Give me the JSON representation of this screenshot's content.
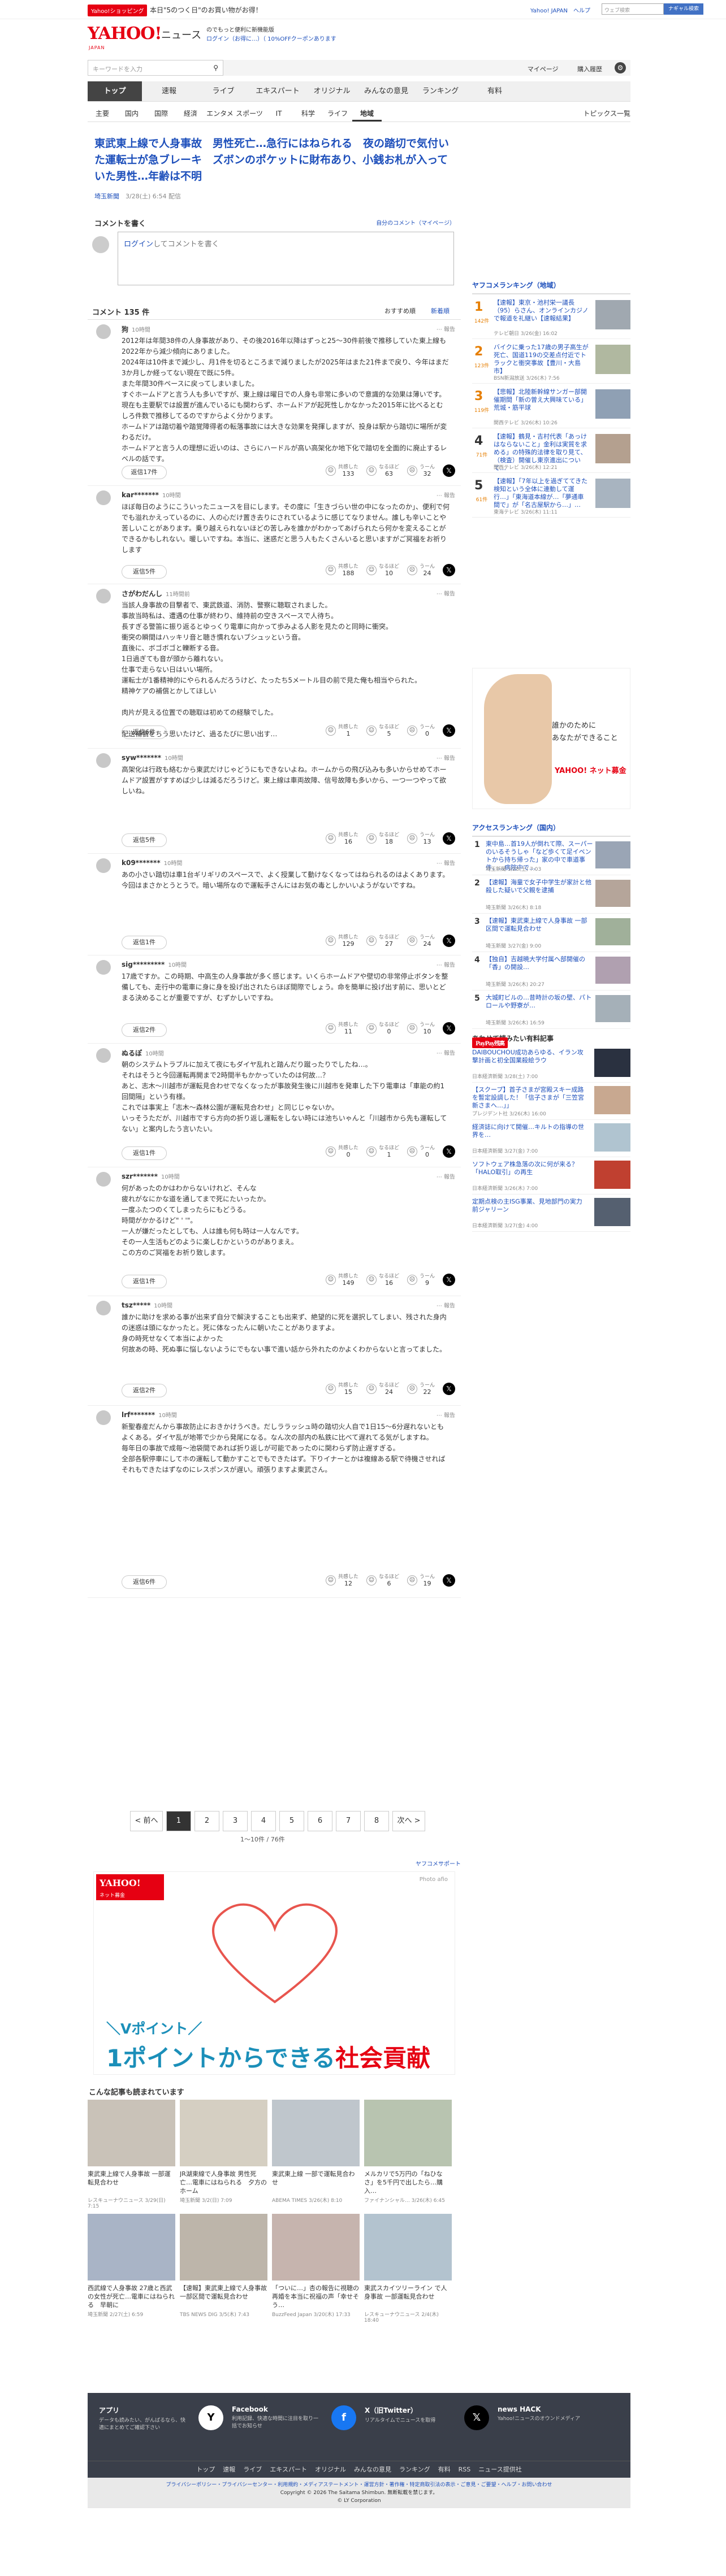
{
  "promo": {
    "badge": "Yahoo!ショッピング",
    "text": "本日\"5のつく日\"のお買い物がお得！",
    "right": "Yahoo! JAPAN　ヘルプ",
    "search_placeholder": "ウェブ検索",
    "search_btn": "ナギャル検索"
  },
  "header": {
    "logo": "YAHOO!",
    "logo_sub": "JAPAN",
    "news": "ニュース",
    "msg1": "LYPプレミアム",
    "msg2": "ログイン（お得に…）（ 10%OFFクーポンあります",
    "msg3": "のでもっと便利に新機能版"
  },
  "bar": {
    "search_placeholder": "キーワードを入力",
    "links": [
      "マイページ",
      "購入履歴"
    ]
  },
  "gnav": [
    "トップ",
    "速報",
    "ライブ",
    "エキスパート",
    "オリジナル",
    "みんなの意見",
    "ランキング",
    "有料"
  ],
  "snav": [
    "主要",
    "国内",
    "国際",
    "経済",
    "エンタメ",
    "スポーツ",
    "IT",
    "科学",
    "ライフ",
    "地域"
  ],
  "snav_right": "トピックス一覧",
  "article": {
    "title": "東武東上線で人身事故　男性死亡…急行にはねられる　夜の踏切で気付いた運転士が急ブレーキ　ズボンのポケットに財布あり、小銭お札が入っていた男性…年齢は不明",
    "publisher": "埼玉新聞",
    "date": "3/28(土) 6:54 配信"
  },
  "comment_head": {
    "title": "コメントを書く",
    "link": "自分のコメント（マイページ）",
    "placeholder_link": "ログイン",
    "placeholder": "してコメントを書く"
  },
  "clist": {
    "title": "コメント 135 件",
    "sort1": "おすすめ順",
    "sort2": "新着順"
  },
  "comments": [
    {
      "user": "狗",
      "time": "10時間",
      "body": "2012年は年間38件の人身事故があり、その後2016年以降はずっと25～30件前後で推移していた東上線も2022年から減少傾向にありました。\n2024年は10件まで減少し、月1件を切るところまで減りましたが2025年はまた21件まで戻り、今年はまだ3か月しか経ってない現在で既に5件。\nまた年間30件ペースに戻ってしまいました。\nすぐホームドアと言う人も多いですが、東上線は曜日での人身も非常に多いので意識的な効果は薄いです。\n現在も主要駅では設置が進んでいるにも関わらず、ホームドアが起死性しかなかった2015年に比べるとむしろ件数で推移してるのですからよく分かります。\nホームドアは踏切着や踏覚障得者の転落事故には大きな効果を発揮しますが、投身は駅から踏切に場所が変わるだけ。\nホームドアと言う人の理想に近いのは、さらにハードルが高い高架化か地下化で踏切を全面的に廃止するレベルの話です。",
      "reply": "返信17件",
      "reacts": [
        {
          "l": "共感した",
          "n": "133"
        },
        {
          "l": "なるほど",
          "n": "63"
        },
        {
          "l": "うーん",
          "n": "32"
        }
      ]
    },
    {
      "user": "kar*******",
      "time": "10時間",
      "body": "ほぼ毎日のようにこういったニュースを目にします。その度に「生きづらい世の中になったのか」、便利で何でも溢れかえっているのに、人の心だけ置き去りにされているように感じてなりません。誰しも辛いことや苦しいことがあります。乗り越えられないほどの苦しみを誰かがわかってあげられたら何かを変えることができるかもしれない。暖しいですね。本当に、迷惑だと思う人もたくさんいると思いますがご冥福をお祈りします",
      "reply": "返信5件",
      "reacts": [
        {
          "l": "共感した",
          "n": "188"
        },
        {
          "l": "なるほど",
          "n": "10"
        },
        {
          "l": "うーん",
          "n": "24"
        }
      ]
    },
    {
      "user": "さがわだんし",
      "time": "11時間前",
      "body": "当該人身事故の目撃者で、東武鉄道、消防、警察に聴取されました。\n事故当時私は、遭遇の仕事が終わり、維持前の空きスペースで人待ち。\n長すぎる警笛に振り返るとゆっくり電車に向かって歩みよる人影を見たのと同時に衝突。\n衝突の瞬間はハッキリ音と聴き慣れないブシュッという音。\n直後に、ボゴボゴと轢断する音。\n1日過ぎても音が頭から離れない。\n仕事で走らない日はいい場所。\n運転士が1番精神的にやられるんだろうけど、たったち5メートル目の前で見た俺も相当やられた。\n精神ケアの補償とかしてほしい\n\n肉片が見える位置での聴取は初めての経験でした。\n\n配送補償をちう思いたけど、過るたびに思い出す…",
      "reply": "返信6件",
      "reacts": [
        {
          "l": "共感した",
          "n": "1"
        },
        {
          "l": "なるほど",
          "n": "5"
        },
        {
          "l": "うーん",
          "n": "0"
        }
      ]
    },
    {
      "user": "syw*******",
      "time": "10時間",
      "body": "高架化は行政も絡むから東武だけじゃどうにもできないよね。ホームからの飛び込みも多いからせめてホームドア設置がすすめば少しは減るだろうけど。東上線は車両故障、信号故障も多いから、一つ一つやって欲しいね。",
      "reply": "返信5件",
      "reacts": [
        {
          "l": "共感した",
          "n": "16"
        },
        {
          "l": "なるほど",
          "n": "18"
        },
        {
          "l": "うーん",
          "n": "13"
        }
      ]
    },
    {
      "user": "k09*******",
      "time": "10時間",
      "body": "あの小さい踏切は車1台ギリギリのスペースで、よく授業して動けなくなってはねられるのはよくあります。今回はまさかとうとうで。暗い場所なので運転手さんにはお気の毒としかいいようがないですね。",
      "reply": "返信1件",
      "reacts": [
        {
          "l": "共感した",
          "n": "129"
        },
        {
          "l": "なるほど",
          "n": "27"
        },
        {
          "l": "うーん",
          "n": "24"
        }
      ]
    },
    {
      "user": "sig*********",
      "time": "10時間",
      "body": "17歳ですか。この時期、中高生の人身事故が多く感じます。いくらホームドアや壁切の非常停止ボタンを整備しても、走行中の電車に身に身を投げ出されたらほぼ間際でしょう。命を簡単に投げ出す前に、思いとどまる決めることが重要ですが、むずかしいですね。",
      "reply": "返信2件",
      "reacts": [
        {
          "l": "共感した",
          "n": "11"
        },
        {
          "l": "なるほど",
          "n": "0"
        },
        {
          "l": "うーん",
          "n": "10"
        }
      ]
    },
    {
      "user": "ぬるぽ",
      "time": "10時間",
      "body": "朝のシステムトラブルに加えて夜にもダイヤ乱れと踏んだり蹴ったりでしたね…。\nそれはそうと今回運転再開まで2時間半もかかっていたのは何故…？\nあと、志木〜川越市が運転見合わせでなくなったが事故発生後に川越市を発車した下り電車は「車能の約1回間隔」という有様。\nこれでは事実上「志木〜森林公園が運転見合わせ」と同じじゃないか。\nいっそうただが、川越市ですら方向の折り返し運転をしない時には池ちいゃんと「川越市から先も運転してない」と案内したう言いたい。",
      "reply": "返信1件",
      "reacts": [
        {
          "l": "共感した",
          "n": "0"
        },
        {
          "l": "なるほど",
          "n": "1"
        },
        {
          "l": "うーん",
          "n": "0"
        }
      ]
    },
    {
      "user": "szr*******",
      "time": "10時間",
      "body": "何があったのかはわからないけれど、そんな\n疲れがなにかな道を通してまで死にたいったか。\n一度ふたつのくてしまったらにもどうる。\n時間がかかるけど\" ' '\"。\n一人が嫌だったとしても、人は誰も何も時は一人なんです。\nその一人生活もどのように楽しむかというのがありまえ。\nこの方のご冥福をお祈り致します。",
      "reply": "返信1件",
      "reacts": [
        {
          "l": "共感した",
          "n": "149"
        },
        {
          "l": "なるほど",
          "n": "16"
        },
        {
          "l": "うーん",
          "n": "9"
        }
      ]
    },
    {
      "user": "tsz*****",
      "time": "10時間",
      "body": "誰かに助けを求める事が出来ず自分で解決することも出来ず、絶望的に死を選択してしまい、残された身内の迷惑は頭になかったと。死に体なったんに朝いたことがありますよ。\n身の時死せなくて本当によかった\n何故あの時、死ぬ事に悩しないようにでもない事で進い話から外れたのかよくわからないと言ってました。",
      "reply": "返信2件",
      "reacts": [
        {
          "l": "共感した",
          "n": "15"
        },
        {
          "l": "なるほど",
          "n": "24"
        },
        {
          "l": "うーん",
          "n": "22"
        }
      ]
    },
    {
      "user": "lrf*******",
      "time": "10時間",
      "body": "新聖春産だんから事故防止におきかけうべき。だしララッシュ時の踏切火人自で1日15〜6分遅れないともよくある。ダイヤ乱が地帯で少から発尾になる。なん次の部内の私鉄に比べて遅れてる気がしますね。\n毎年日の事故で成毎〜池袋間であれば折り返しが可能であったのに関わらず防止遅すぎる。\n全部各駅停車にしてホの運転して動かすことでもできたはず。下りイナーとかは複線ある駅で待機させればそれもできたはずなのにレスポンスが遅い。頑張りますよ東武さん。",
      "reply": "返信6件",
      "reacts": [
        {
          "l": "共感した",
          "n": "12"
        },
        {
          "l": "なるほど",
          "n": "6"
        },
        {
          "l": "うーん",
          "n": "19"
        }
      ]
    }
  ],
  "pager": {
    "prev": "< 前へ",
    "pages": [
      "1",
      "2",
      "3",
      "4",
      "5",
      "6",
      "7",
      "8"
    ],
    "next": "次へ >",
    "count": "1〜10件 / 76件"
  },
  "sponsor_label": "ヤフコメサポート",
  "ad": {
    "brand": "YAHOO!",
    "brand_sub": "ネット募金",
    "photo": "Photo afio",
    "line1": "＼Vポイント／",
    "line2a": "1ポイントからできる",
    "line2b": "社会貢献"
  },
  "recos": {
    "title": "こんな記事も読まれています",
    "items": [
      {
        "cap": "東武東上線で人身事故 一部運転見合わせ",
        "meta": "レスキューナウニュース 3/29(日) 7:15"
      },
      {
        "cap": "JR湖東線で人身事故 男性死亡…電車にはねられる　夕方のホーム",
        "meta": "埼玉新聞 3/2(日) 7:09"
      },
      {
        "cap": "東武東上線 一部で運転見合わせ",
        "meta": "ABEMA TIMES 3/26(木) 8:10"
      },
      {
        "cap": "メルカリで5万円の「ねひなさ」を5千円で出したら…購入…",
        "meta": "ファイナンシャル… 3/26(木) 6:45"
      },
      {
        "cap": "西武線で人身事故 27歳と西武の女性が死亡…電車にはねられる　早朝に",
        "meta": "埼玉新聞 2/27(土) 6:59"
      },
      {
        "cap": "【速報】東武東上線で人身事故　一部区間で運転見合わせ",
        "meta": "TBS NEWS DIG 3/5(木) 7:43"
      },
      {
        "cap": "「ついに…」杏の報告に視聴の再婚を本当に祝福の声「幸せそう…",
        "meta": "BuzzFeed Japan 3/20(木) 17:33"
      },
      {
        "cap": "東武スカイツリーライン で人身事故 一部運転見合わせ",
        "meta": "レスキューナウニュース 2/4(木) 18:40"
      }
    ]
  },
  "sidebar": {
    "ranking_title": "ヤフコメランキング（地域）",
    "ranks": [
      {
        "n": "1",
        "cnt": "142件",
        "txt": "【速報】東京・池村栄一議長（95）らさん、オンラインカジノで報道を礼継い【速報結果】",
        "src": "テレビ朝日 3/26(金) 16:02"
      },
      {
        "n": "2",
        "cnt": "123件",
        "txt": "バイクに乗った17歳の男子高生が死亡、国道119の交差点付近でトラックと衝突事故【豊川・大島市】",
        "src": "BSN新潟放送 3/26(木) 7:56"
      },
      {
        "n": "3",
        "cnt": "119件",
        "txt": "【悲報】北陸新幹線サンガー部開催期間「新の曽え大興味ている」荒城・筋平球",
        "src": "関西テレビ 3/26(木) 10:26"
      },
      {
        "n": "4",
        "cnt": "71件",
        "txt": "【速報】鶴見・吉村代表「あっけはならないこと」金利は実質を求める」の特殊的法律を取り見て、（検査）開催し東京進出について…",
        "src": "関西テレビ 3/26(木) 12:21"
      },
      {
        "n": "5",
        "cnt": "61件",
        "txt": "【速報】「7年以上を過ぎててきた検知という全体に連動して運行…」「東海道本線が…「夢通車間で」が「名古屋駅から…」…",
        "src": "東海テレビ 3/26(木) 11:11"
      }
    ],
    "ad_t1": "誰かのために",
    "ad_t2": "あなたができること",
    "ad_brand": "YAHOO! ネット募金",
    "access_title": "アクセスランキング（国内）",
    "access": [
      {
        "n": "1",
        "txt": "東中島…首19人が倒れて際、スーパーのいるそうしゃ「など歩くて足イベントから持ち帰った」家の中で車道事件、…病院中で…",
        "src": "埼玉新聞 3/28(土) 7:03"
      },
      {
        "n": "2",
        "txt": "【速報】海童で女子中学生が家計と他殺した疑いで父親を逮捕",
        "src": "埼玉新聞 3/26(木) 8:18"
      },
      {
        "n": "3",
        "txt": "【速報】東武東上線で人身事故 一部区間で運転見合わせ",
        "src": "埼玉新聞 3/27(金) 9:00"
      },
      {
        "n": "4",
        "txt": "【独自】吉越暁大学付属へ部開催の「香」の開設…",
        "src": "埼玉新聞 3/26(木) 20:27"
      },
      {
        "n": "5",
        "txt": "大城町ビルの…昔時計の坂の壁、パトロールや野寮が…",
        "src": "埼玉新聞 3/26(木) 16:59"
      }
    ],
    "pp_head": "あわせて読みたい有料記事",
    "pp_logo": "PayPay残高",
    "pp": [
      {
        "txt": "DAIBOUCHOU成功あらゆる、イラン攻撃計画と初全国業殺絵ラウ",
        "src": "日本経済新聞 3/28(土) 7:00"
      },
      {
        "txt": "【スクープ】首子さまが宮殿スキー成路を暫定設調した！「信子さまが「三笠宮新さまへ…」」",
        "src": "プレジデント社 3/26(木) 16:00"
      },
      {
        "txt": "経済誌に向けて開催…キルトの指導の世界を…",
        "src": "日本経済新聞 3/27(金) 7:00"
      },
      {
        "txt": "ソフトウェア株急落の次に何が来る？「HALO取引」の再生",
        "src": "日本経済新聞 3/26(木) 7:00"
      },
      {
        "txt": "定期点検の主ISG事業、見地部門の実力前ジャリーン",
        "src": "日本経済新聞 3/27(金) 4:00"
      }
    ]
  },
  "footer": {
    "cols": [
      {
        "h": "アプリ",
        "d": "データも読みたい、がんばるなら、快適にまとめてご確認下さい"
      },
      {
        "h": "Facebook",
        "d": "利用記録、快適な時間に注目を取り一括でお知らせ"
      },
      {
        "h": "X（旧Twitter）",
        "d": "リアルタイムでニュースを取得"
      },
      {
        "h": "news HACK",
        "d": "Yahoo!ニュースのオウンドメディア"
      }
    ],
    "links": [
      "トップ",
      "速報",
      "ライブ",
      "エキスパート",
      "オリジナル",
      "みんなの意見",
      "ランキング",
      "有料",
      "RSS",
      "ニュース提供社"
    ],
    "legal": "プライバシーポリシー・プライバシーセンター・利用規約・メディアステートメント・運営方針・著作権・特定商取引法の表示・ご意見・ご要望・ヘルプ・お問い合わせ",
    "copy1": "Copyright © 2026 The Saitama Shimbun. 無断転載を禁じます。",
    "copy2": "© LY Corporation"
  }
}
